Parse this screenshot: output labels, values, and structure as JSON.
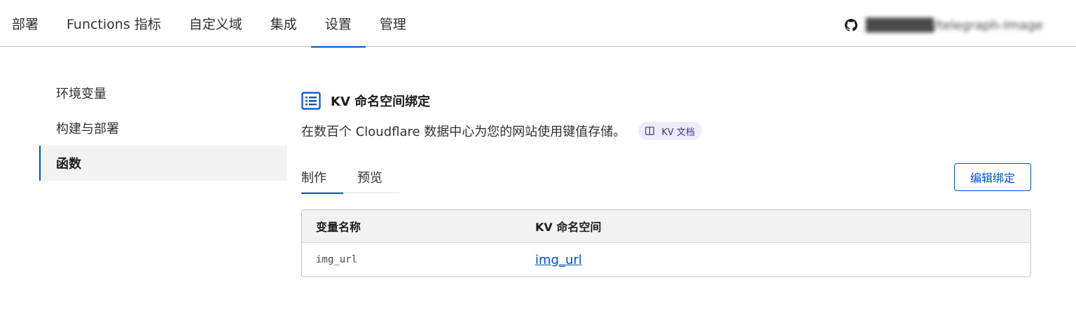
{
  "nav": {
    "tabs": [
      {
        "label": "部署"
      },
      {
        "label": "Functions 指标"
      },
      {
        "label": "自定义域"
      },
      {
        "label": "集成"
      },
      {
        "label": "设置",
        "active": true
      },
      {
        "label": "管理"
      }
    ],
    "repo": {
      "icon": "github-icon",
      "name": "███████/telegraph-Image"
    }
  },
  "sidebar": {
    "items": [
      {
        "label": "环境变量"
      },
      {
        "label": "构建与部署"
      },
      {
        "label": "函数",
        "active": true
      }
    ]
  },
  "main": {
    "section_icon": "list-document-icon",
    "title": "KV 命名空间绑定",
    "description": "在数百个 Cloudflare 数据中心为您的网站使用键值存储。",
    "doc_link": {
      "icon": "book-icon",
      "label": "KV 文档"
    },
    "subtabs": [
      {
        "label": "制作",
        "active": true
      },
      {
        "label": "预览"
      }
    ],
    "edit_button": "编辑绑定",
    "table": {
      "headers": [
        "变量名称",
        "KV 命名空间"
      ],
      "rows": [
        {
          "variable": "img_url",
          "namespace": "img_url"
        }
      ]
    }
  },
  "colors": {
    "accent": "#0051c3",
    "chip_bg": "#efebfb",
    "header_bg": "#f2f2f2"
  }
}
